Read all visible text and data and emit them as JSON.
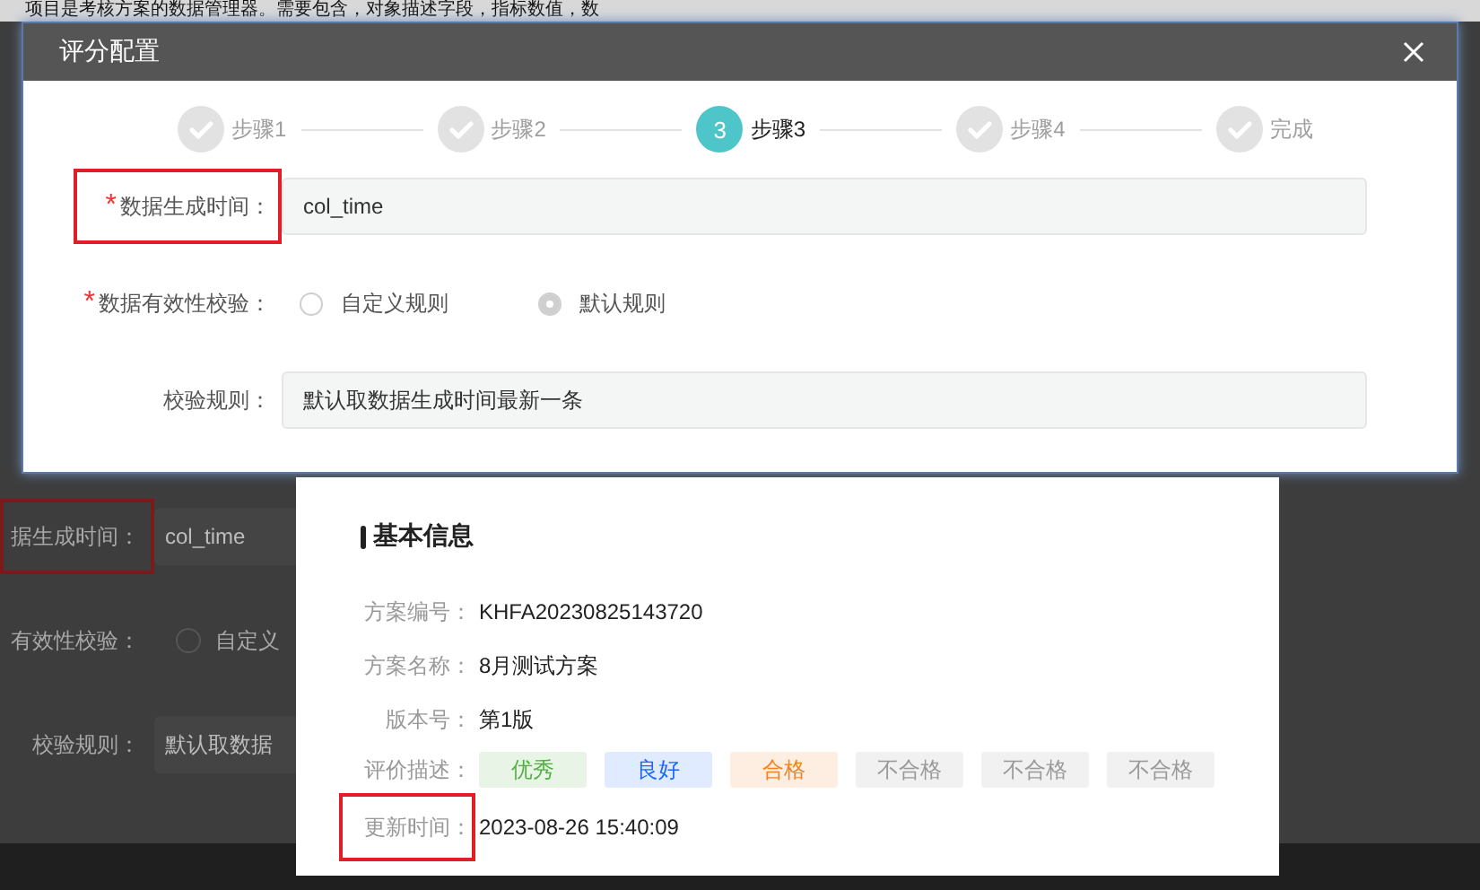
{
  "background_document": {
    "text": "项目是考核方案的数据管理器。需要包含，对象描述字段，指标数值，数"
  },
  "underlying_form": {
    "fields": [
      {
        "kind": "input",
        "label": "据生成时间：",
        "value": "col_time",
        "highlighted": true
      },
      {
        "kind": "radio",
        "label": "有效性校验：",
        "options": [
          {
            "label": "自定义",
            "selected": false
          }
        ]
      },
      {
        "kind": "input",
        "label": "校验规则：",
        "value": "默认取数据",
        "highlighted": false
      }
    ]
  },
  "dialog": {
    "title": "评分配置",
    "steps": [
      {
        "label": "步骤1",
        "completed": true
      },
      {
        "label": "步骤2",
        "completed": true
      },
      {
        "label": "步骤3",
        "completed": false,
        "number": "3"
      },
      {
        "label": "步骤4",
        "completed": true
      },
      {
        "label": "完成",
        "completed": true
      }
    ],
    "fields": [
      {
        "kind": "input",
        "label": "数据生成时间：",
        "required_mark": "*",
        "value": "col_time",
        "highlighted": true
      },
      {
        "kind": "radio",
        "label": "数据有效性校验：",
        "required_mark": "*",
        "options": [
          {
            "label": "自定义规则",
            "selected": false
          },
          {
            "label": "默认规则",
            "selected": true
          }
        ]
      },
      {
        "kind": "input",
        "label": "校验规则：",
        "value": "默认取数据生成时间最新一条",
        "highlighted": false
      }
    ]
  },
  "card": {
    "title": "基本信息",
    "rows": [
      {
        "kind": "text",
        "label": "方案编号：",
        "value": "KHFA20230825143720",
        "highlighted": false
      },
      {
        "kind": "text",
        "label": "方案名称：",
        "value": "8月测试方案",
        "highlighted": false
      },
      {
        "kind": "text",
        "label": "版本号：",
        "value": "第1版",
        "highlighted": false
      },
      {
        "kind": "tags",
        "label": "评价描述：",
        "tags": [
          {
            "label": "优秀",
            "color": "#52b043"
          },
          {
            "label": "良好",
            "color": "#1a66ff"
          },
          {
            "label": "合格",
            "color": "#f5821f"
          },
          {
            "label": "不合格",
            "color": "#999999"
          },
          {
            "label": "不合格",
            "color": "#999999"
          },
          {
            "label": "不合格",
            "color": "#999999"
          }
        ]
      },
      {
        "kind": "text",
        "label": "更新时间：",
        "value": "2023-08-26 15:40:09",
        "highlighted": true
      }
    ]
  }
}
